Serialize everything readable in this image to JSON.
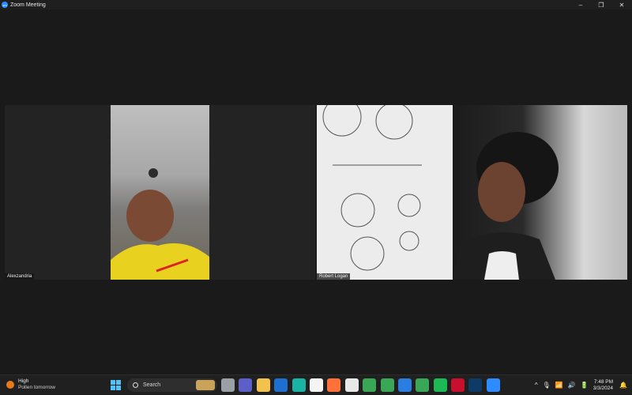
{
  "window": {
    "title": "Zoom Meeting",
    "controls": [
      "–",
      "❐",
      "✕"
    ]
  },
  "participants": [
    {
      "name": "Alexzandria"
    },
    {
      "name": "Robert Logan"
    }
  ],
  "taskbar": {
    "weather": {
      "main": "High",
      "sub": "Pollen tomorrow"
    },
    "search_label": "Search",
    "pinned_icons": [
      "chrome-icon",
      "file-explorer-icon",
      "teams-icon",
      "folder-icon",
      "store-icon",
      "edge-icon",
      "calendar-icon",
      "firefox-icon",
      "notepad-icon",
      "chrome-icon",
      "chrome-icon",
      "photos-icon",
      "chrome-icon",
      "spotify-icon",
      "mcafee-icon",
      "lightroom-icon",
      "zoom-icon"
    ],
    "tray": {
      "chevron": "^",
      "mic": "🎙",
      "wifi": "📶",
      "volume": "🔊",
      "battery": "🔋"
    },
    "clock": {
      "time": "7:48 PM",
      "date": "3/3/2024"
    }
  },
  "colors": {
    "accent": "#2d8cff",
    "taskbar": "#202020",
    "stage": "#1a1a1a"
  }
}
